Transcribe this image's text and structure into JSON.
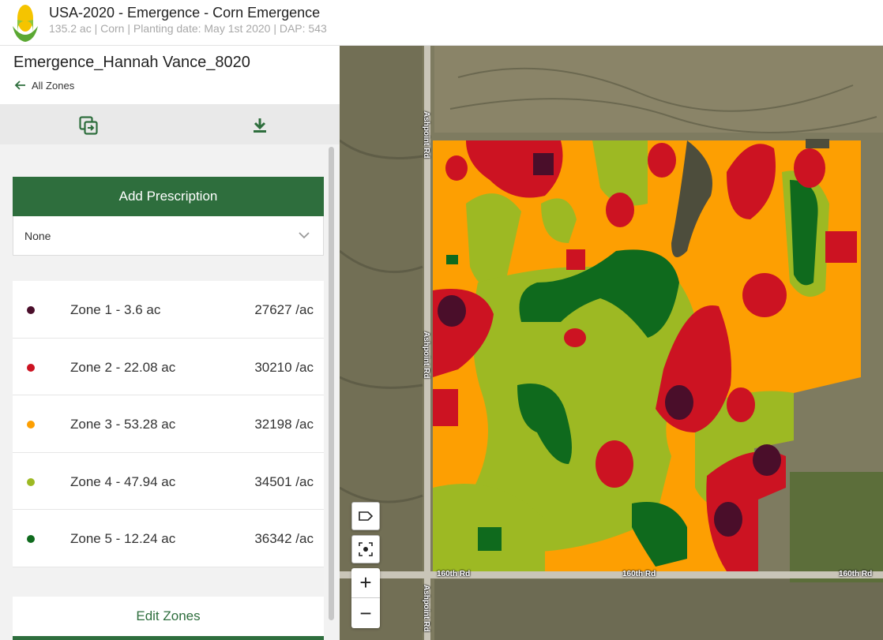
{
  "header": {
    "title": "USA-2020 - Emergence - Corn Emergence",
    "subtitle": "135.2 ac | Corn | Planting date: May 1st 2020 | DAP: 543",
    "logo_icon": "corn-logo-icon"
  },
  "panel": {
    "zone_set_name": "Emergence_Hannah Vance_8020",
    "back_label": "All Zones",
    "toolbar_icons": [
      "copy-export-icon",
      "download-icon"
    ],
    "add_prescription_label": "Add Prescription",
    "prescription_select": {
      "value": "None"
    },
    "zones": [
      {
        "label": "Zone 1 - 3.6 ac",
        "rate": "27627 /ac",
        "color": "#4a0e2a"
      },
      {
        "label": "Zone 2 - 22.08 ac",
        "rate": "30210 /ac",
        "color": "#cc1322"
      },
      {
        "label": "Zone 3 - 53.28 ac",
        "rate": "32198 /ac",
        "color": "#fd9f02"
      },
      {
        "label": "Zone 4 - 47.94 ac",
        "rate": "34501 /ac",
        "color": "#9db923"
      },
      {
        "label": "Zone 5 - 12.24 ac",
        "rate": "36342 /ac",
        "color": "#0f6a1d"
      }
    ],
    "edit_zones_label": "Edit Zones"
  },
  "map": {
    "road_labels": {
      "ashpoint_top": "Ashpoint Rd",
      "ashpoint_mid": "Ashpoint Rd",
      "ashpoint_bottom": "Ashpoint Rd",
      "sixtieth_left": "160th Rd",
      "sixtieth_mid": "160th Rd",
      "sixtieth_right": "160th Rd"
    },
    "controls": {
      "label_toggle_icon": "tag-icon",
      "fit_bounds_icon": "focus-icon",
      "zoom_in": "+",
      "zoom_out": "−"
    }
  },
  "colors": {
    "brand_green": "#2e6e3d"
  }
}
